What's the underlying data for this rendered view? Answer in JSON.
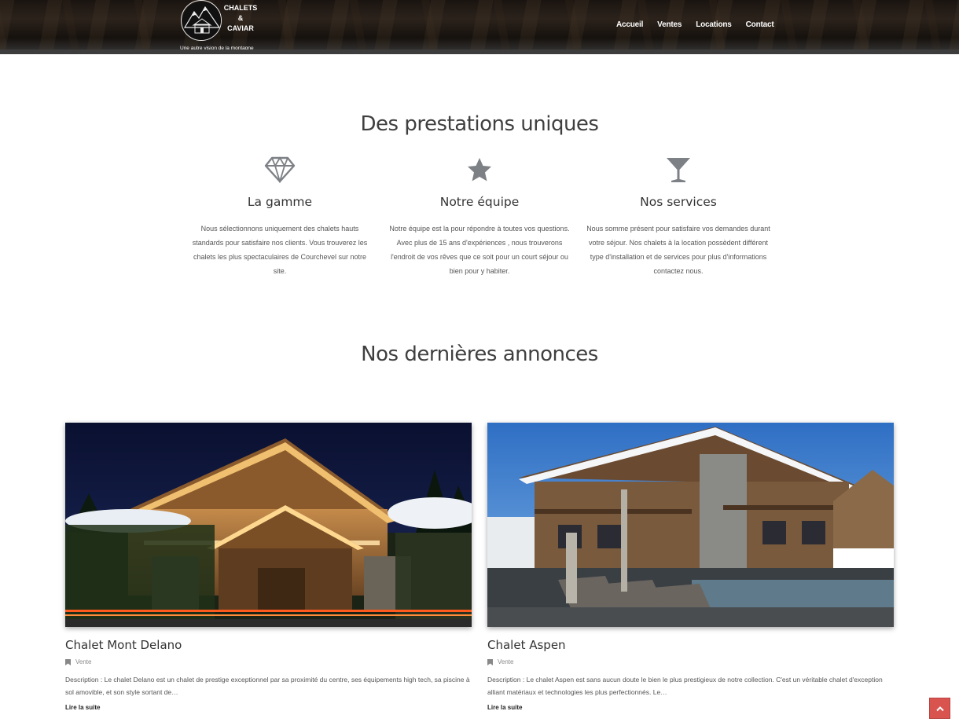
{
  "header": {
    "logo_line1": "CHALETS",
    "logo_line2": "&",
    "logo_line3": "CAVIAR",
    "tagline": "Une autre vision de la montagne",
    "nav": [
      "Accueil",
      "Ventes",
      "Locations",
      "Contact"
    ]
  },
  "services": {
    "title": "Des prestations uniques",
    "items": [
      {
        "icon": "diamond-icon",
        "title": "La gamme",
        "text": "Nous sélectionnons uniquement des chalets hauts standards pour satisfaire nos clients. Vous trouverez les chalets les plus spectaculaires de Courchevel sur notre site."
      },
      {
        "icon": "star-icon",
        "title": "Notre équipe",
        "text": "Notre équipe est la pour répondre à toutes vos questions. Avec plus de 15 ans d'expériences , nous trouverons l'endroit de vos rêves que ce soit pour un court séjour ou bien pour y habiter."
      },
      {
        "icon": "cocktail-glass-icon",
        "title": "Nos services",
        "text": "Nous somme présent pour satisfaire vos demandes durant votre séjour. Nos chalets à la location possèdent différent type d'installation et de services pour plus d'informations contactez nous."
      }
    ]
  },
  "listings": {
    "title": "Nos dernières annonces",
    "items": [
      {
        "title": "Chalet Mont Delano",
        "category": "Vente",
        "description": "Description : Le chalet Delano est un chalet de prestige exceptionnel par sa proximité du centre, ses équipements high tech, sa piscine à sol amovible, et son style sortant de…",
        "link": "Lire la suite"
      },
      {
        "title": "Chalet Aspen",
        "category": "Vente",
        "description": "Description : Le chalet Aspen est sans aucun doute le bien le plus prestigieux de notre collection. C'est un véritable chalet d'exception alliant matériaux et technologies les plus perfectionnés. Le…",
        "link": "Lire la suite"
      }
    ]
  },
  "colors": {
    "accent": "#d9534f",
    "icon_gray": "#7d8186"
  }
}
